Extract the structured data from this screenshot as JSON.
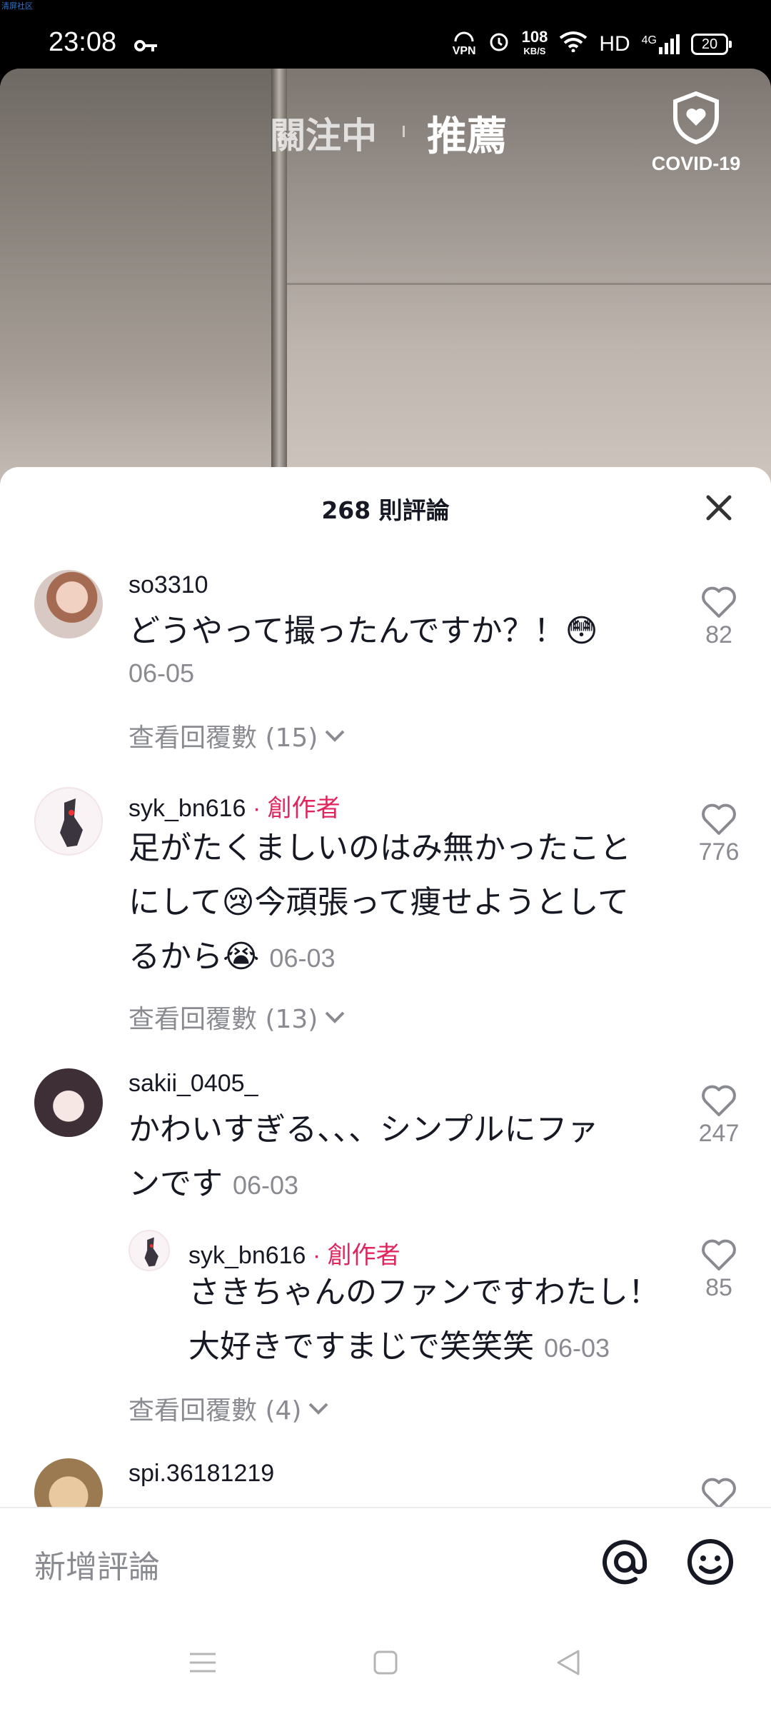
{
  "status_bar": {
    "corner_label": "清屏社区",
    "time": "23:08",
    "network_speed": "108",
    "network_unit": "KB/S",
    "hd": "HD",
    "signal_type": "4G",
    "vpn": "VPN",
    "battery": "20"
  },
  "top_nav": {
    "following": "關注中",
    "recommended": "推薦",
    "covid": "COVID-19"
  },
  "sheet": {
    "title": "268 則評論"
  },
  "comments": [
    {
      "user": "so3310",
      "text": "どうやって撮ったんですか？！😳",
      "date": "06-05",
      "likes": "82",
      "replies": "查看回覆數 (15)"
    },
    {
      "user": "syk_bn616",
      "creator_tag": " · 創作者",
      "text_lines": [
        "足がたくましいのはみ無かったこと",
        "にして😢今頑張って痩せようとして",
        "るから😭"
      ],
      "date": "06-03",
      "likes": "776",
      "replies": "查看回覆數 (13)"
    },
    {
      "user": "sakii_0405_",
      "text_lines": [
        "かわいすぎる、、、シンプルにファ",
        "ンです"
      ],
      "date": "06-03",
      "likes": "247",
      "reply": {
        "user": "syk_bn616",
        "creator_tag": " · 創作者",
        "text_lines": [
          "さきちゃんのファンですわたし！",
          "大好きですまじで笑笑笑"
        ],
        "date": "06-03",
        "likes": "85"
      },
      "replies": "查看回覆數 (4)"
    },
    {
      "user": "spi.36181219"
    }
  ],
  "input": {
    "placeholder": "新增評論"
  },
  "icons": {
    "mention": "at-icon",
    "emoji": "emoji-icon",
    "close": "close-icon",
    "like": "heart-icon"
  }
}
